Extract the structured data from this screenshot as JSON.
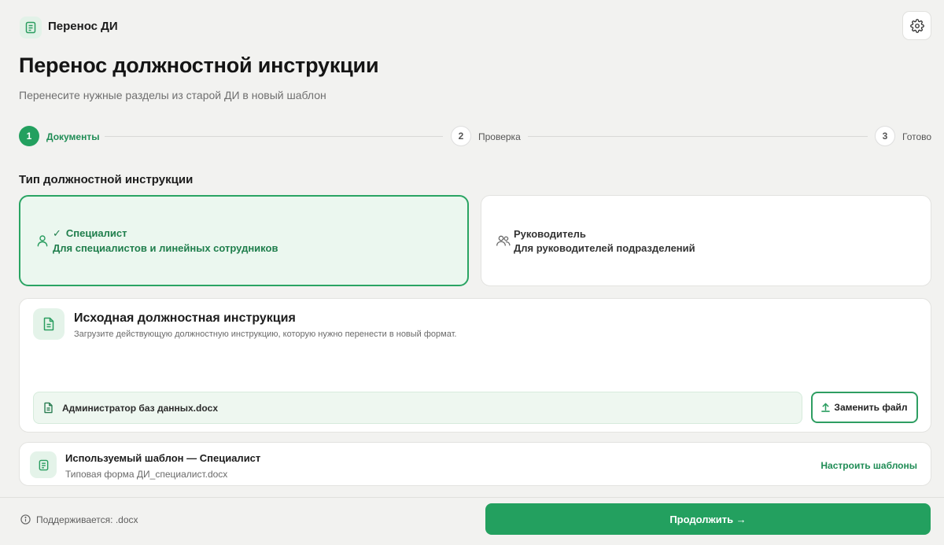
{
  "app": {
    "title": "Перенос ДИ"
  },
  "page": {
    "title": "Перенос должностной инструкции",
    "subtitle": "Перенесите нужные разделы из старой ДИ в новый шаблон"
  },
  "stepper": {
    "steps": [
      {
        "number": "1",
        "label": "Документы",
        "state": "active"
      },
      {
        "number": "2",
        "label": "Проверка",
        "state": "idle"
      },
      {
        "number": "3",
        "label": "Готово",
        "state": "idle"
      }
    ]
  },
  "type_section": {
    "title": "Тип должностной инструкции",
    "options": [
      {
        "check": "✓",
        "name": "Специалист",
        "description": "Для специалистов и линейных сотрудников",
        "selected": true,
        "icon": "user-icon"
      },
      {
        "name": "Руководитель",
        "description": "Для руководителей подразделений",
        "selected": false,
        "icon": "users-icon"
      }
    ]
  },
  "upload": {
    "title": "Исходная должностная инструкция",
    "description": "Загрузите действующую должностную инструкцию, которую нужно перенести в новый формат.",
    "file_name": "Администратор баз данных.docx",
    "replace_label": "Заменить файл"
  },
  "template": {
    "title": "Используемый шаблон — Специалист",
    "file": "Типовая форма ДИ_специалист.docx",
    "configure_label": "Настроить шаблоны"
  },
  "footer": {
    "supported": "Поддерживается: .docx",
    "continue_label": "Продолжить →"
  },
  "colors": {
    "accent": "#23a05f",
    "accent_text": "#1f8c55",
    "background": "#f2f2f0",
    "selected_card_bg": "#ebf7ef"
  }
}
